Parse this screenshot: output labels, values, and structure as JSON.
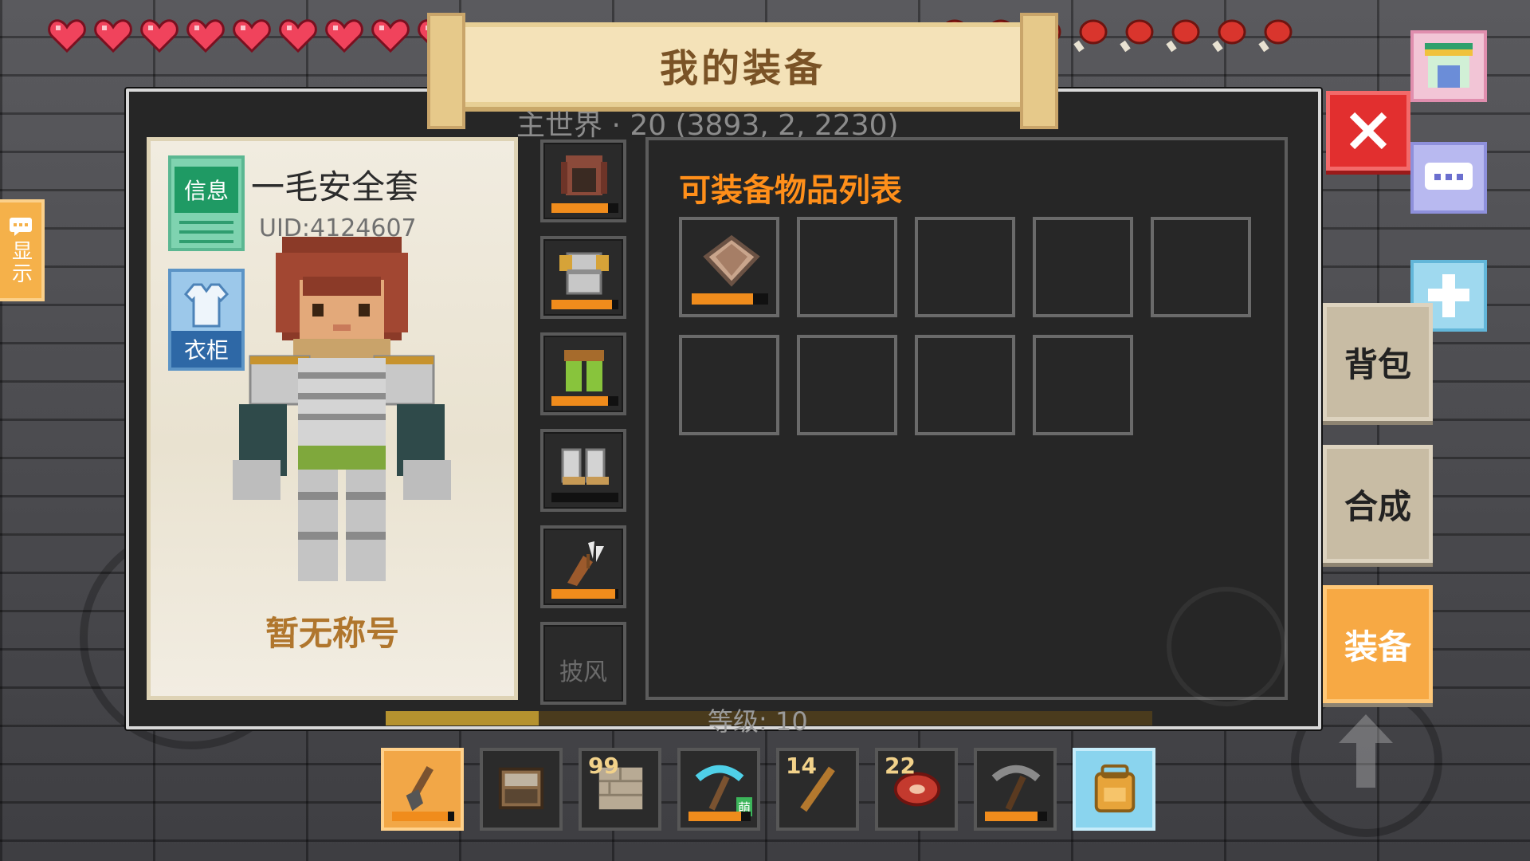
{
  "hud": {
    "hearts_count": 9,
    "food_count": 8,
    "heart_color": "#f0435c",
    "food_color": "#d9352d"
  },
  "panel": {
    "title": "我的装备",
    "world_info": "主世界 · 20  (3893, 2, 2230)"
  },
  "character": {
    "info_button": "信息",
    "wardrobe_button": "衣柜",
    "name": "一毛安全套",
    "uid": "UID:4124607",
    "title_text": "暂无称号"
  },
  "equipment_slots": [
    {
      "name": "helmet",
      "icon": "hood-icon",
      "durability": 0.85
    },
    {
      "name": "chest",
      "icon": "chestplate-icon",
      "durability": 0.9
    },
    {
      "name": "legs",
      "icon": "leggings-icon",
      "durability": 0.85
    },
    {
      "name": "boots",
      "icon": "boots-icon",
      "durability": 0
    },
    {
      "name": "quiver",
      "icon": "quiver-icon",
      "durability": 0.95
    },
    {
      "name": "cape",
      "label": "披风"
    }
  ],
  "inventory": {
    "title": "可装备物品列表",
    "cells": [
      {
        "icon": "shield-icon",
        "durability": 0.8
      },
      {},
      {},
      {},
      {},
      {},
      {},
      {},
      {}
    ]
  },
  "level": {
    "text": "等级:  10",
    "progress": 0.2
  },
  "side_tabs": {
    "backpack": "背包",
    "craft": "合成",
    "equip": "装备"
  },
  "left_tab": {
    "label": "显示"
  },
  "hotbar": [
    {
      "icon": "shovel-icon",
      "count": "",
      "durability": 0.9,
      "selected": true
    },
    {
      "icon": "workbench-icon",
      "count": ""
    },
    {
      "icon": "stone-brick-icon",
      "count": "99"
    },
    {
      "icon": "diamond-pickaxe-icon",
      "count": "",
      "durability": 0.85,
      "badge": "萌"
    },
    {
      "icon": "stick-icon",
      "count": "14"
    },
    {
      "icon": "meat-icon",
      "count": "22"
    },
    {
      "icon": "stone-pickaxe-icon",
      "count": "",
      "durability": 0.85
    },
    {
      "icon": "backpack-icon",
      "count": "",
      "bag": true
    }
  ]
}
